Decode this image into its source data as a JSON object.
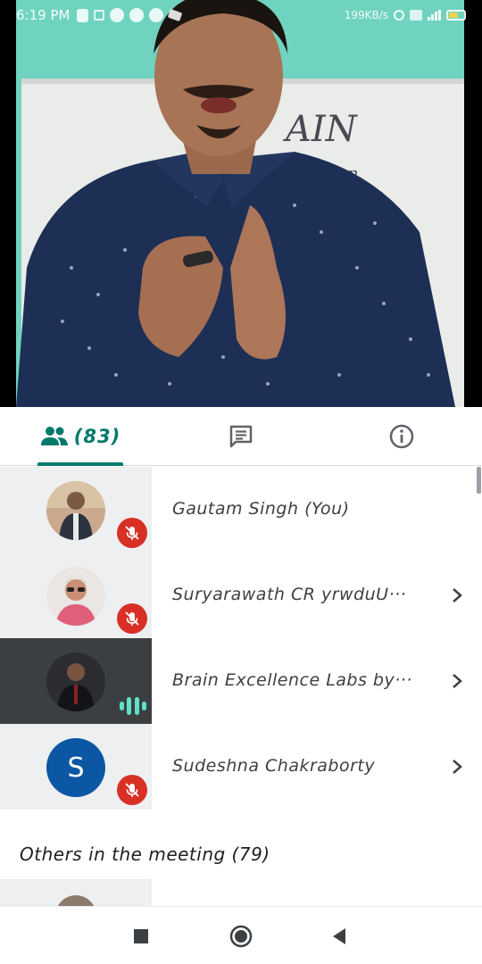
{
  "status_bar": {
    "time": "6:19 PM",
    "network_speed": "199KB/s",
    "left_icons": [
      "shield-icon",
      "vibrate-icon",
      "whatsapp-icon",
      "messenger-icon",
      "chat-icon",
      "telegram-icon"
    ],
    "right_icons": [
      "alarm-icon",
      "wifi-icon",
      "signal-icon",
      "battery-icon"
    ]
  },
  "video": {
    "board_text_1": "AIN",
    "board_text_2": "motion"
  },
  "tabs": [
    {
      "icon": "people-icon",
      "label": "(83)",
      "active": true
    },
    {
      "icon": "chat-icon",
      "label": "",
      "active": false
    },
    {
      "icon": "info-icon",
      "label": "",
      "active": false
    }
  ],
  "participants": [
    {
      "name": "Gautam Singh (You)",
      "avatar": "photo",
      "mic": "muted",
      "has_chevron": false,
      "active": false
    },
    {
      "name": "Suryarawath CR yrwduU···",
      "avatar": "photo",
      "mic": "muted",
      "has_chevron": true,
      "active": false
    },
    {
      "name": "Brain Excellence Labs by···",
      "avatar": "photo",
      "mic": "speaking",
      "has_chevron": true,
      "active": true
    },
    {
      "name": "Sudeshna Chakraborty",
      "avatar": "S",
      "mic": "muted",
      "has_chevron": true,
      "active": false
    }
  ],
  "others_heading": "Others in the meeting (79)",
  "nav": {
    "buttons": [
      "recents-square-icon",
      "home-circle-icon",
      "back-triangle-icon"
    ]
  },
  "colors": {
    "accent": "#00796b",
    "muted_red": "#d93025",
    "avatar_blue": "#0b57a4",
    "active_row": "#3c3f42",
    "speaking": "#5fe0c8"
  }
}
